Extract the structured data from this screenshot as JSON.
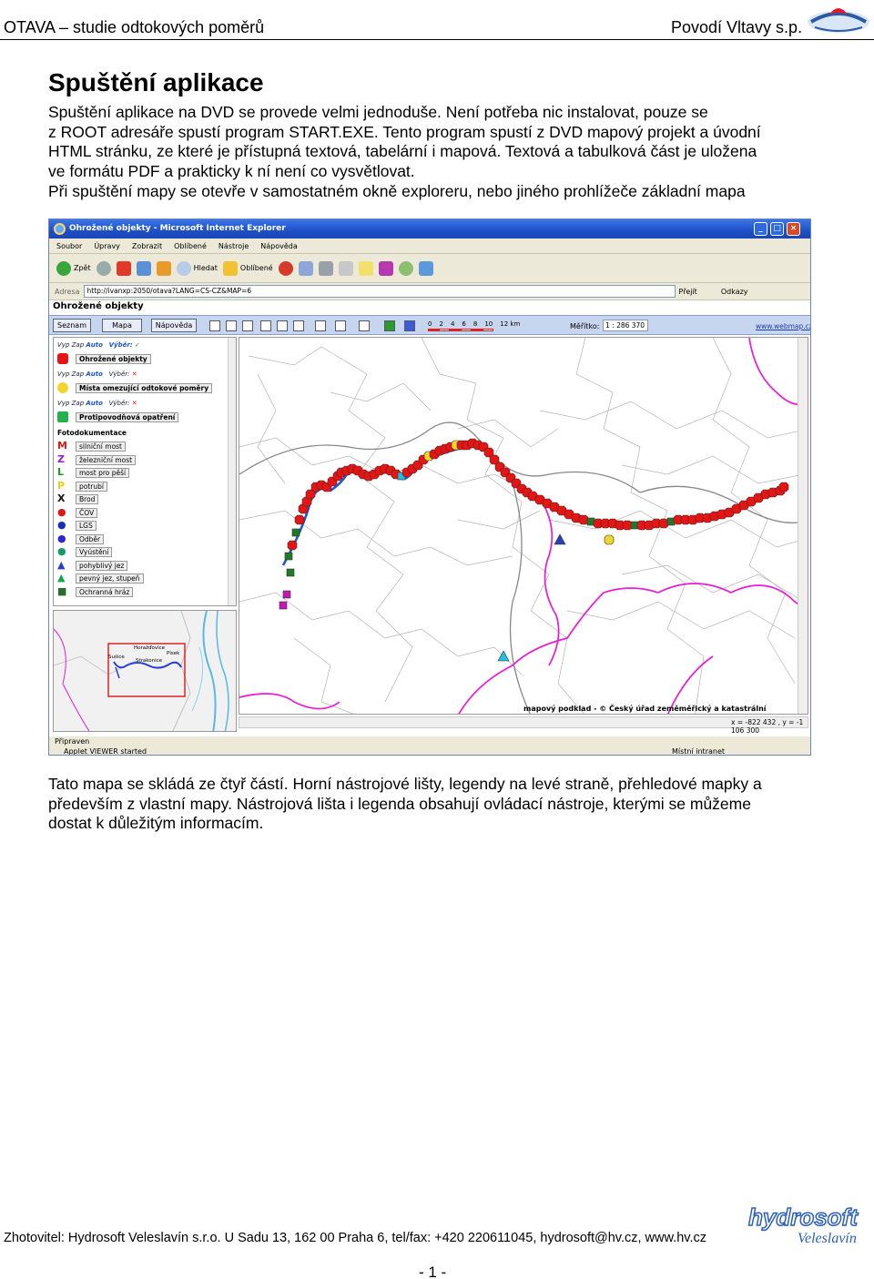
{
  "header": {
    "left": "OTAVA – studie odtokových poměrů",
    "right": "Povodí Vltavy s.p."
  },
  "title": "Spuštění aplikace",
  "intro_lines": [
    "Spuštění aplikace na DVD se provede velmi jednoduše. Není potřeba nic instalovat, pouze se",
    "z ROOT adresáře spustí program START.EXE. Tento program spustí z DVD mapový projekt a úvodní",
    "HTML stránku, ze které je přístupná textová, tabelární i mapová. Textová a tabulková část je uložena",
    "ve formátu PDF a prakticky k ní není co vysvětlovat.",
    "Při spuštění mapy se otevře v samostatném okně exploreru, nebo jiného prohlížeče základní mapa"
  ],
  "screenshot": {
    "window_title": "Ohrožené objekty - Microsoft Internet Explorer",
    "menu": [
      "Soubor",
      "Úpravy",
      "Zobrazit",
      "Oblíbené",
      "Nástroje",
      "Nápověda"
    ],
    "toolbar": {
      "back": "Zpět",
      "search": "Hledat",
      "favorites": "Oblíbené"
    },
    "address_label": "Adresa",
    "address": "http://ivanxp:2050/otava?LANG=CS-CZ&MAP=6",
    "go": "Přejít",
    "links": "Odkazy",
    "app_title": "Ohrožené objekty",
    "tabs": [
      "Seznam",
      "Mapa",
      "Nápověda"
    ],
    "scale_labels": [
      "0",
      "2",
      "4",
      "6",
      "8",
      "10",
      "12 km"
    ],
    "scale_label": "Měřítko:",
    "scale_value": "1 : 286 370",
    "web_link": "www.webmap.cz",
    "legend": {
      "head_cols": [
        "Vyp",
        "Zap",
        "Auto"
      ],
      "head_select": "Výběr:",
      "layers": [
        {
          "label": "Ohrožené objekty",
          "check": "✓",
          "color": "#e81414"
        },
        {
          "label": "Místa omezující odtokové poměry",
          "check": "✕",
          "color": "#f2d52a"
        },
        {
          "label": "Protipovodňová opatření",
          "check": "✕",
          "color": "#22b14c"
        }
      ],
      "group": "Fotodokumentace",
      "items": [
        {
          "sym": "M",
          "label": "silniční most",
          "color": "#e0181a"
        },
        {
          "sym": "Z",
          "label": "železniční most",
          "color": "#8d1fd0"
        },
        {
          "sym": "L",
          "label": "most pro pěší",
          "color": "#1f9a24"
        },
        {
          "sym": "P",
          "label": "potrubí",
          "color": "#e8cf16"
        },
        {
          "sym": "X",
          "label": "Brod",
          "color": "#111111"
        },
        {
          "sym": "●",
          "label": "ČOV",
          "color": "#e0181a"
        },
        {
          "sym": "●",
          "label": "LGS",
          "color": "#1b2fb5"
        },
        {
          "sym": "●",
          "label": "Odběr",
          "color": "#2a2ad0"
        },
        {
          "sym": "●",
          "label": "Vyústění",
          "color": "#139c6a"
        },
        {
          "sym": "▲",
          "label": "pohyblivý jez",
          "color": "#2a3fb8"
        },
        {
          "sym": "▲",
          "label": "pevný jez, stupeň",
          "color": "#17a34a"
        },
        {
          "sym": "■",
          "label": "Ochranná hráz",
          "color": "#2a6d2a"
        }
      ]
    },
    "overview_places": [
      "Horažďovice",
      "Sušice",
      "Strakonice",
      "Písek"
    ],
    "map_credit": "mapový podklad - © Český úřad zeměměřický a katastrální",
    "coords": "x = -822 432 , y = -1 106 300",
    "status_ready": "Připraven",
    "status_applet": "Applet VIEWER started",
    "status_zone": "Místní intranet"
  },
  "after_lines": [
    "Tato mapa se skládá ze čtyř částí. Horní nástrojové lišty, legendy na levé straně, přehledové mapky a",
    "především z vlastní mapy. Nástrojová lišta i legenda obsahují ovládací nástroje, kterými se můžeme",
    "dostat k důležitým informacím."
  ],
  "footer": "Zhotovitel: Hydrosoft Veleslavín s.r.o. U Sadu 13, 162 00 Praha 6, tel/fax: +420 220611045, hydrosoft@hv.cz, www.hv.cz",
  "footer_logo": {
    "line1": "hydrosoft",
    "line2": "Veleslavín"
  },
  "page_number": "- 1 -",
  "colors": {
    "accent_blue": "#1b45b5",
    "river": "#1f55d8",
    "border": "#e81bd6",
    "marker_red": "#e81414"
  }
}
